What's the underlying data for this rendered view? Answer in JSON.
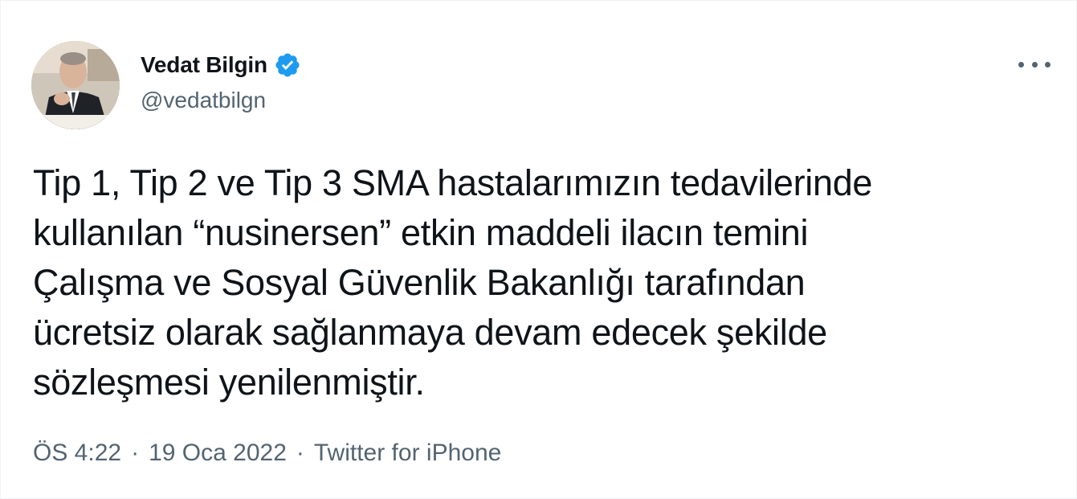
{
  "author": {
    "name": "Vedat Bilgin",
    "handle": "@vedatbilgn",
    "verified": true
  },
  "tweet": {
    "text": "Tip 1, Tip 2 ve Tip 3 SMA hastalarımızın tedavilerinde\nkullanılan “nusinersen” etkin maddeli ilacın temini\nÇalışma ve Sosyal Güvenlik Bakanlığı tarafından\nücretsiz olarak sağlanmaya devam edecek şekilde\nsözleşmesi yenilenmiştir."
  },
  "meta": {
    "time": "ÖS 4:22",
    "separator": "·",
    "date": "19 Oca 2022",
    "source": "Twitter for iPhone"
  },
  "icons": {
    "verified": "verified-badge-icon",
    "more": "more-horizontal-icon"
  },
  "colors": {
    "text": "#0f1419",
    "secondary": "#536471",
    "verified": "#1d9bf0"
  }
}
